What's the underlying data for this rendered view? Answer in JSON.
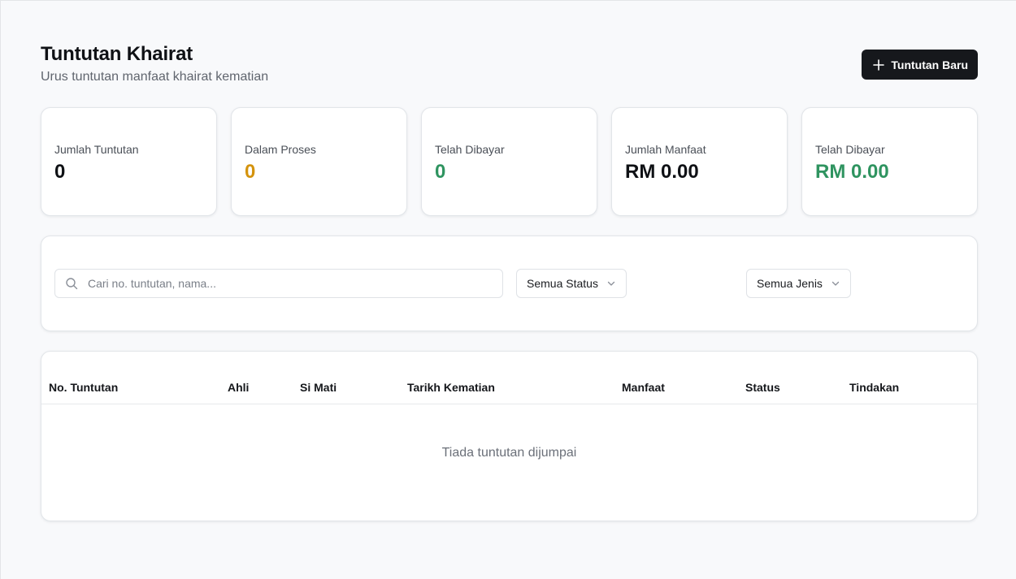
{
  "header": {
    "title": "Tuntutan Khairat",
    "subtitle": "Urus tuntutan manfaat khairat kematian",
    "new_button_label": "Tuntutan Baru"
  },
  "stats": [
    {
      "label": "Jumlah Tuntutan",
      "value": "0",
      "color": "#0f1115"
    },
    {
      "label": "Dalam Proses",
      "value": "0",
      "color": "#d4930d"
    },
    {
      "label": "Telah Dibayar",
      "value": "0",
      "color": "#2f9460"
    },
    {
      "label": "Jumlah Manfaat",
      "value": "RM 0.00",
      "color": "#0f1115"
    },
    {
      "label": "Telah Dibayar",
      "value": "RM 0.00",
      "color": "#2f9460"
    }
  ],
  "filters": {
    "search_placeholder": "Cari no. tuntutan, nama...",
    "status_selected": "Semua Status",
    "type_selected": "Semua Jenis"
  },
  "table": {
    "columns": [
      "No. Tuntutan",
      "Ahli",
      "Si Mati",
      "Tarikh Kematian",
      "Manfaat",
      "Status",
      "Tindakan"
    ],
    "empty_message": "Tiada tuntutan dijumpai"
  },
  "icons": {
    "new_button": "plus-icon",
    "search": "search-icon",
    "select": "chevron-down-icon"
  }
}
